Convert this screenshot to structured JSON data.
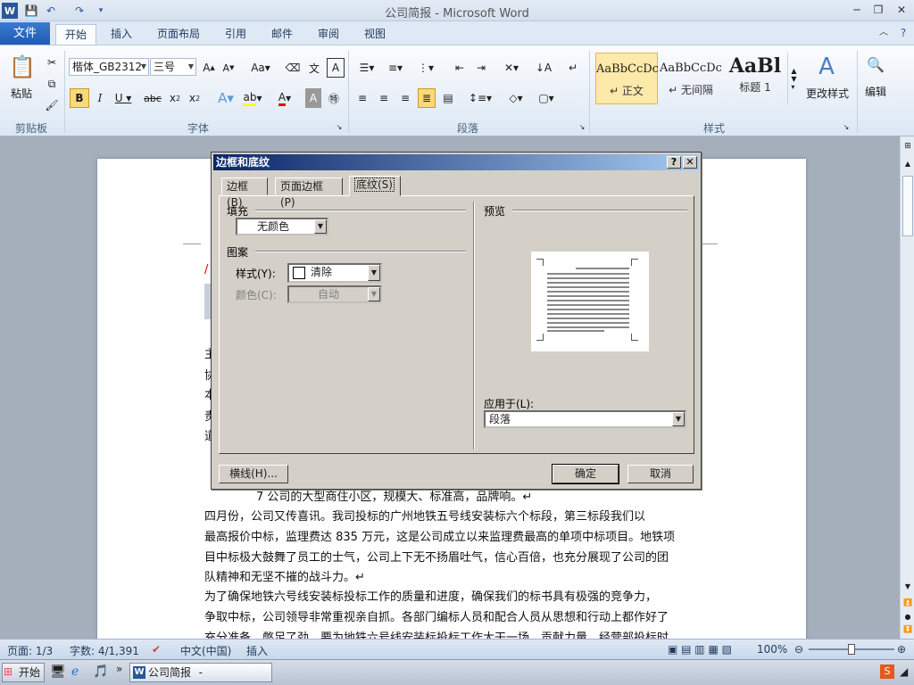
{
  "window": {
    "title": "公司简报  -  Microsoft Word"
  },
  "ribbon": {
    "file_tab": "文件",
    "tabs": [
      "开始",
      "插入",
      "页面布局",
      "引用",
      "邮件",
      "审阅",
      "视图"
    ],
    "clipboard": {
      "paste": "粘贴",
      "group": "剪贴板"
    },
    "font": {
      "name": "楷体_GB2312",
      "size": "三号",
      "group": "字体"
    },
    "paragraph": {
      "group": "段落"
    },
    "styles": {
      "group": "样式",
      "items": [
        {
          "preview": "AaBbCcDc",
          "label": "↵ 正文"
        },
        {
          "preview": "AaBbCcDc",
          "label": "↵ 无间隔"
        },
        {
          "preview": "AaBl",
          "label": "标题 1"
        }
      ],
      "change": "更改样式"
    },
    "editing": {
      "label": "编辑"
    }
  },
  "document": {
    "lines": [
      "主",
      "协",
      "本",
      "责",
      "道",
      "7      公司的大型商住小区，规模大、标准高，品牌响。↵",
      "    四月份，公司又传喜讯。我司投标的广州地铁五号线安装标六个标段，第三标段我们以",
      "最高报价中标，监理费达 835 万元，这是公司成立以来监理费最高的单项中标项目。地铁项",
      "目中标极大鼓舞了员工的士气，公司上下无不扬眉吐气，信心百倍，也充分展现了公司的团",
      "队精神和无坚不摧的战斗力。↵",
      "    为了确保地铁六号线安装标投标工作的质量和进度，确保我们的标书具有极强的竞争力，",
      "争取中标，公司领导非常重视亲自抓。各部门编标人员和配合人员从思想和行动上都作好了",
      "充分准备，憋足了劲，要为地铁六号线安装标投标工作大干一场，贡献力量。经营部投标时，"
    ]
  },
  "status": {
    "page": "页面: 1/3",
    "words": "字数: 4/1,391",
    "lang": "中文(中国)",
    "mode": "插入",
    "zoom": "100%"
  },
  "taskbar": {
    "start": "开始",
    "word_task": "公司简报 - Microsof..."
  },
  "dialog": {
    "title": "边框和底纹",
    "help": "?",
    "close": "✕",
    "tabs": [
      "边框(B)",
      "页面边框(P)",
      "底纹(S)"
    ],
    "fill_label": "填充",
    "fill_value": "无颜色",
    "pattern_label": "图案",
    "style_label": "样式(Y):",
    "style_value": "清除",
    "color_label": "颜色(C):",
    "color_value": "自动",
    "preview_label": "预览",
    "apply_label": "应用于(L):",
    "apply_value": "段落",
    "hline_button": "横线(H)...",
    "ok_button": "确定",
    "cancel_button": "取消"
  }
}
